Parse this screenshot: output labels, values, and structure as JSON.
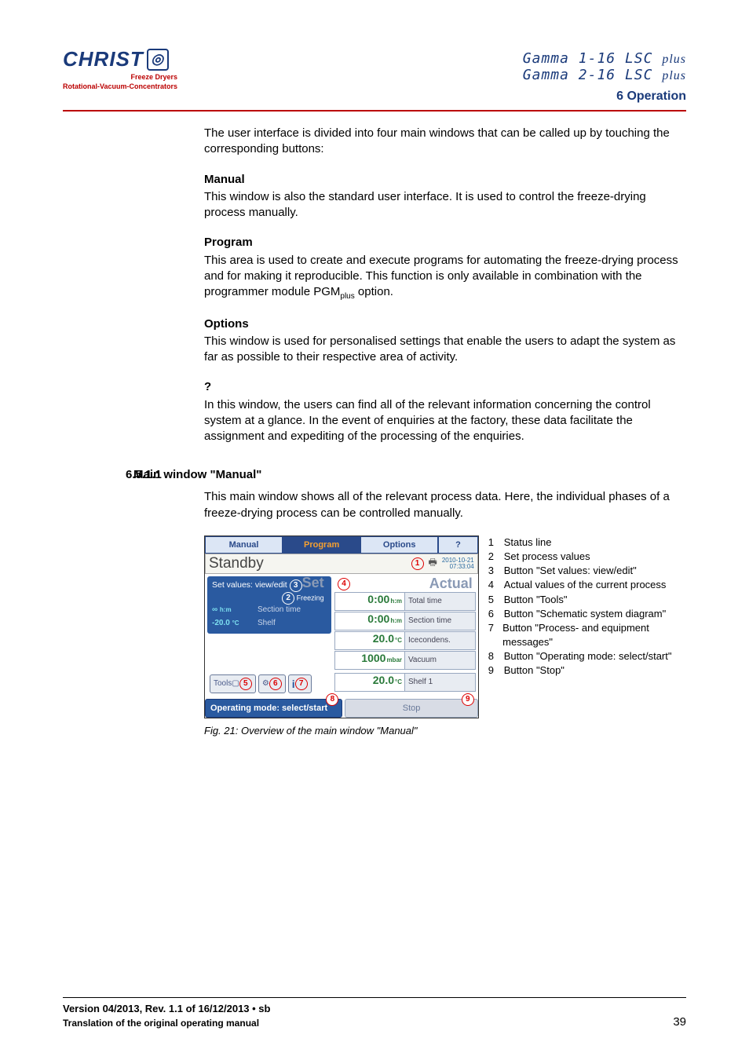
{
  "header": {
    "logo_main": "CHRIST",
    "logo_sub1": "Freeze Dryers",
    "logo_sub2": "Rotational-Vacuum-Concentrators",
    "model1_a": "Gamma 1-16 LSC",
    "model1_b": "plus",
    "model2_a": "Gamma 2-16 LSC",
    "model2_b": "plus",
    "section": "6 Operation"
  },
  "intro": "The user interface is divided into four main windows that can be called up by touching the corresponding buttons:",
  "manual": {
    "h": "Manual",
    "p": "This window is also the standard user interface. It is used to control the freeze-drying process manually."
  },
  "program": {
    "h": "Program",
    "p_a": "This area is used to create and execute programs for automating the freeze-drying process and for making it reproducible. This function is only available in combination with the programmer module PGM",
    "p_b": " option."
  },
  "options": {
    "h": "Options",
    "p": "This window is used for personalised settings that enable the users to adapt the system as far as possible to their respective area of activity."
  },
  "help": {
    "h": "?",
    "p": "In this window, the users can find all of the relevant information concerning the control system at a glance. In the event of enquiries at the factory, these data facilitate the assignment and expediting of the processing of the enquiries."
  },
  "subsec": {
    "num": "6.5.1.1",
    "title": "Main window \"Manual\"",
    "p": "This main window shows all of the relevant process data. Here, the individual phases of a freeze-drying process can be controlled manually."
  },
  "shot": {
    "tabs": {
      "manual": "Manual",
      "program": "Program",
      "options": "Options",
      "help": "?"
    },
    "standby": "Standby",
    "date": "2010-10-21",
    "time": "07:33:04",
    "set_hdr": "Set values: view/edit",
    "set_tag": "Set",
    "freezing": "Freezing",
    "set_rows": [
      {
        "val": "∞",
        "unit": "h:m",
        "lbl": "Section time"
      },
      {
        "val": "-20.0",
        "unit": "°C",
        "lbl": "Shelf"
      }
    ],
    "actual": "Actual",
    "act_rows": [
      {
        "val": "0:00",
        "unit": "h:m",
        "lbl": "Total time"
      },
      {
        "val": "0:00",
        "unit": "h:m",
        "lbl": "Section time"
      },
      {
        "val": "20.0",
        "unit": "°C",
        "lbl": "Icecondens."
      },
      {
        "val": "1000",
        "unit": "mbar",
        "lbl": "Vacuum"
      },
      {
        "val": "20.0",
        "unit": "°C",
        "lbl": "Shelf 1"
      }
    ],
    "tools": "Tools",
    "op_mode": "Operating mode: select/start",
    "stop": "Stop",
    "m": {
      "1": "1",
      "2": "2",
      "3": "3",
      "4": "4",
      "5": "5",
      "6": "6",
      "7": "7",
      "8": "8",
      "9": "9"
    }
  },
  "legend": [
    {
      "n": "1",
      "t": "Status line"
    },
    {
      "n": "2",
      "t": "Set process values"
    },
    {
      "n": "3",
      "t": "Button \"Set values: view/edit\""
    },
    {
      "n": "4",
      "t": "Actual values of the current process"
    },
    {
      "n": "5",
      "t": "Button \"Tools\""
    },
    {
      "n": "6",
      "t": "Button \"Schematic system diagram\""
    },
    {
      "n": "7",
      "t": "Button \"Process- and equipment messages\""
    },
    {
      "n": "8",
      "t": "Button \"Operating mode: select/start\""
    },
    {
      "n": "9",
      "t": "Button \"Stop\""
    }
  ],
  "caption": "Fig. 21: Overview of the main window \"Manual\"",
  "footer": {
    "version": "Version 04/2013, Rev. 1.1 of 16/12/2013 • sb",
    "trans": "Translation of the original operating manual",
    "page": "39"
  }
}
